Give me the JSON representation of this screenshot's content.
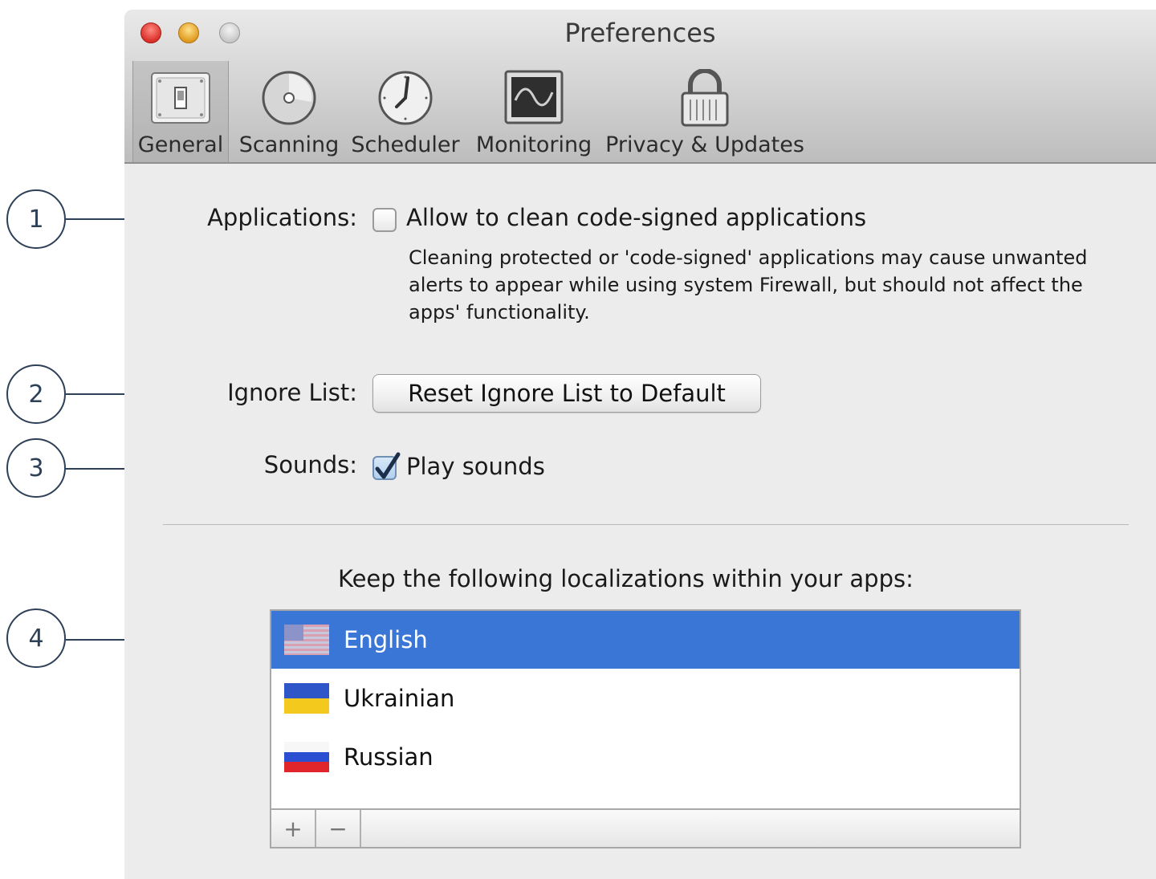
{
  "window": {
    "title": "Preferences"
  },
  "toolbar": {
    "tabs": [
      {
        "label": "General",
        "icon": "switch-icon",
        "selected": true
      },
      {
        "label": "Scanning",
        "icon": "scanning-icon",
        "selected": false
      },
      {
        "label": "Scheduler",
        "icon": "clock-icon",
        "selected": false
      },
      {
        "label": "Monitoring",
        "icon": "monitor-icon",
        "selected": false
      },
      {
        "label": "Privacy & Updates",
        "icon": "lock-icon",
        "selected": false
      }
    ]
  },
  "callouts": [
    "1",
    "2",
    "3",
    "4"
  ],
  "applications": {
    "label": "Applications:",
    "checkbox_label": "Allow to clean code-signed applications",
    "checked": false,
    "description": "Cleaning protected or 'code-signed' applications may cause unwanted alerts to appear while using system Firewall, but should not affect the apps' functionality."
  },
  "ignore_list": {
    "label": "Ignore List:",
    "button_label": "Reset Ignore List to Default"
  },
  "sounds": {
    "label": "Sounds:",
    "checkbox_label": "Play sounds",
    "checked": true
  },
  "localizations": {
    "heading": "Keep the following localizations within your apps:",
    "items": [
      {
        "name": "English",
        "flag": "us-flag-icon",
        "selected": true
      },
      {
        "name": "Ukrainian",
        "flag": "ukraine-flag-icon",
        "selected": false
      },
      {
        "name": "Russian",
        "flag": "russia-flag-icon",
        "selected": false
      }
    ],
    "add_label": "+",
    "remove_label": "−"
  },
  "colors": {
    "selection": "#3a76d6",
    "callout": "#2d4057"
  }
}
